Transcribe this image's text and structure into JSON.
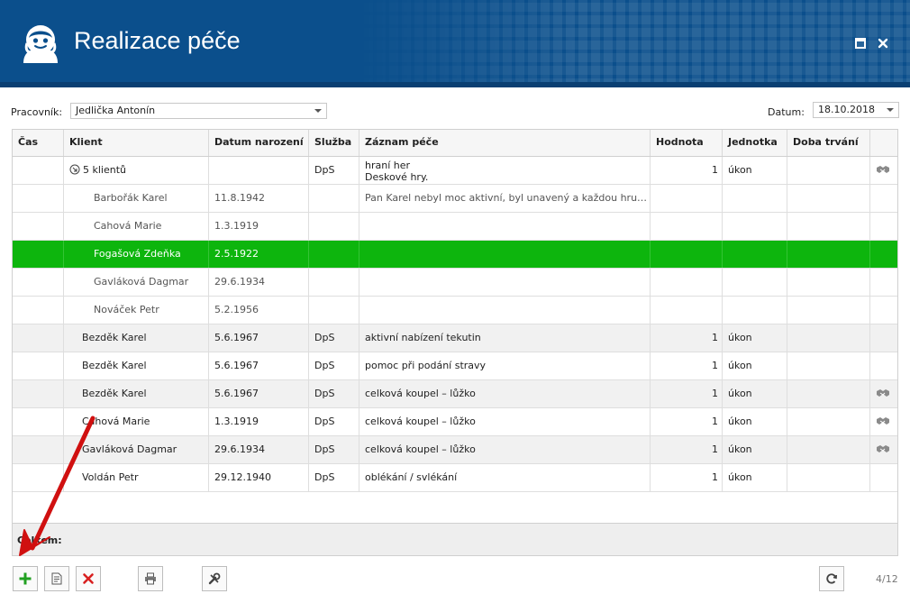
{
  "window": {
    "title": "Realizace péče"
  },
  "filters": {
    "worker_label": "Pracovník:",
    "worker_value": "Jedlička Antonín",
    "date_label": "Datum:",
    "date_value": "18.10.2018"
  },
  "columns": [
    "Čas",
    "Klient",
    "Datum narození",
    "Služba",
    "Záznam péče",
    "Hodnota",
    "Jednotka",
    "Doba trvání"
  ],
  "rows": [
    {
      "time": "",
      "client": "5 klientů",
      "birth": "",
      "service": "DpS",
      "record_line1": "hraní her",
      "record_line2": "Deskové hry.",
      "value": "1",
      "unit": "úkon",
      "duration": ""
    },
    {
      "time": "",
      "client": "Barbořák Karel",
      "birth": "11.8.1942",
      "service": "",
      "record": "Pan Karel nebyl moc aktivní, byl unavený a každou hru…",
      "value": "",
      "unit": "",
      "duration": ""
    },
    {
      "time": "",
      "client": "Cahová Marie",
      "birth": "1.3.1919",
      "service": "",
      "record": "",
      "value": "",
      "unit": "",
      "duration": ""
    },
    {
      "time": "",
      "client": "Fogašová Zdeňka",
      "birth": "2.5.1922",
      "service": "",
      "record": "",
      "value": "",
      "unit": "",
      "duration": ""
    },
    {
      "time": "",
      "client": "Gavláková Dagmar",
      "birth": "29.6.1934",
      "service": "",
      "record": "",
      "value": "",
      "unit": "",
      "duration": ""
    },
    {
      "time": "",
      "client": "Nováček Petr",
      "birth": "5.2.1956",
      "service": "",
      "record": "",
      "value": "",
      "unit": "",
      "duration": ""
    },
    {
      "time": "",
      "client": "Bezděk Karel",
      "birth": "5.6.1967",
      "service": "DpS",
      "record": "aktivní nabízení tekutin",
      "value": "1",
      "unit": "úkon",
      "duration": ""
    },
    {
      "time": "",
      "client": "Bezděk Karel",
      "birth": "5.6.1967",
      "service": "DpS",
      "record": "pomoc při podání stravy",
      "value": "1",
      "unit": "úkon",
      "duration": ""
    },
    {
      "time": "",
      "client": "Bezděk Karel",
      "birth": "5.6.1967",
      "service": "DpS",
      "record": "celková koupel – lůžko",
      "value": "1",
      "unit": "úkon",
      "duration": ""
    },
    {
      "time": "",
      "client": "Cahová Marie",
      "birth": "1.3.1919",
      "service": "DpS",
      "record": "celková koupel – lůžko",
      "value": "1",
      "unit": "úkon",
      "duration": ""
    },
    {
      "time": "",
      "client": "Gavláková Dagmar",
      "birth": "29.6.1934",
      "service": "DpS",
      "record": "celková koupel – lůžko",
      "value": "1",
      "unit": "úkon",
      "duration": ""
    },
    {
      "time": "",
      "client": "Voldán Petr",
      "birth": "29.12.1940",
      "service": "DpS",
      "record": "oblékání / svlékání",
      "value": "1",
      "unit": "úkon",
      "duration": ""
    }
  ],
  "footer": {
    "total_label": "Celkem:"
  },
  "pager": {
    "text": "4/12"
  },
  "colors": {
    "header_bg": "#0b4f8c",
    "selected_row": "#0db50d",
    "add_green": "#21a021",
    "delete_red": "#d82020",
    "annotation_arrow": "#d01010"
  },
  "icons": {
    "logo": "nurse-face-icon",
    "maximize": "maximize-icon",
    "close": "close-icon",
    "handshake": "handshake-icon",
    "add": "plus-icon",
    "edit": "edit-document-icon",
    "delete": "delete-x-icon",
    "print": "printer-icon",
    "tools": "tools-icon",
    "refresh": "refresh-icon",
    "expand": "expand-circle-icon"
  }
}
